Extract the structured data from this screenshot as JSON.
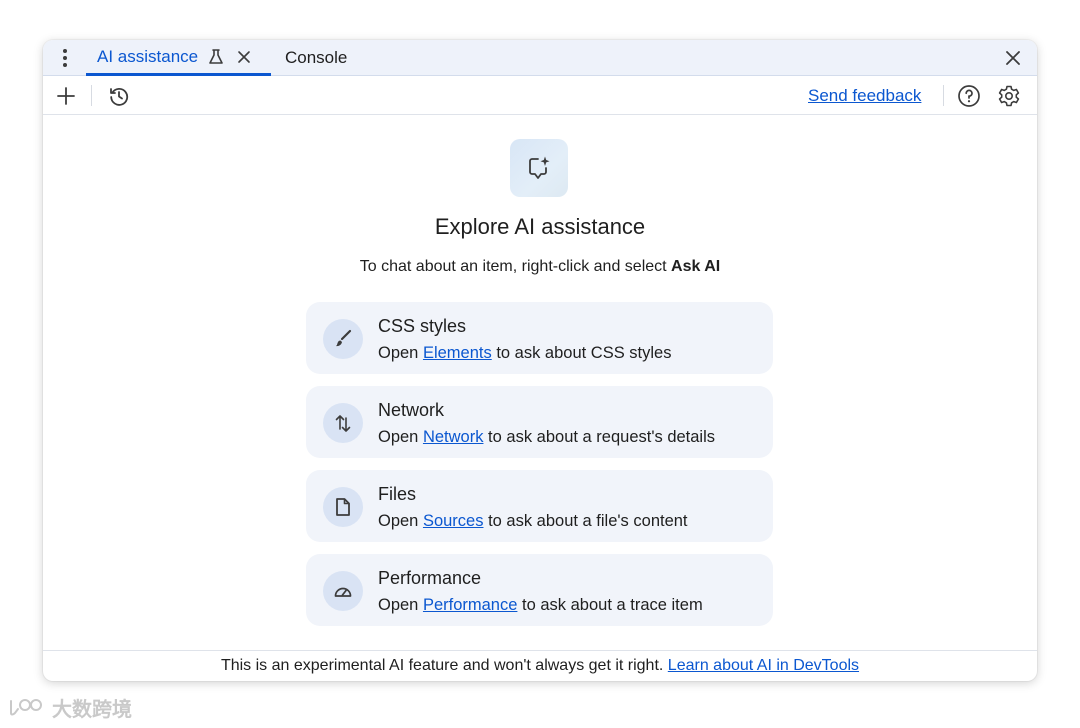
{
  "tabs": {
    "ai_label": "AI assistance",
    "console_label": "Console"
  },
  "toolbar": {
    "send_feedback": "Send feedback"
  },
  "hero": {
    "title": "Explore AI assistance",
    "subtitle_prefix": "To chat about an item, right-click and select ",
    "subtitle_bold": "Ask AI"
  },
  "cards": [
    {
      "title": "CSS styles",
      "prefix": "Open ",
      "link": "Elements",
      "suffix": " to ask about CSS styles",
      "icon": "paintbrush-icon"
    },
    {
      "title": "Network",
      "prefix": "Open ",
      "link": "Network",
      "suffix": " to ask about a request's details",
      "icon": "up-down-arrows-icon"
    },
    {
      "title": "Files",
      "prefix": "Open ",
      "link": "Sources",
      "suffix": " to ask about a file's content",
      "icon": "file-icon"
    },
    {
      "title": "Performance",
      "prefix": "Open ",
      "link": "Performance",
      "suffix": " to ask about a trace item",
      "icon": "speedometer-icon"
    }
  ],
  "footer": {
    "text": "This is an experimental AI feature and won't always get it right. ",
    "link": "Learn about AI in DevTools"
  },
  "watermark": {
    "text": "大数跨境"
  },
  "colors": {
    "accent": "#0b57d0",
    "tabbar_bg": "#eef2fa",
    "card_bg": "#f1f4fa",
    "card_icon_bg": "#d9e3f4"
  }
}
